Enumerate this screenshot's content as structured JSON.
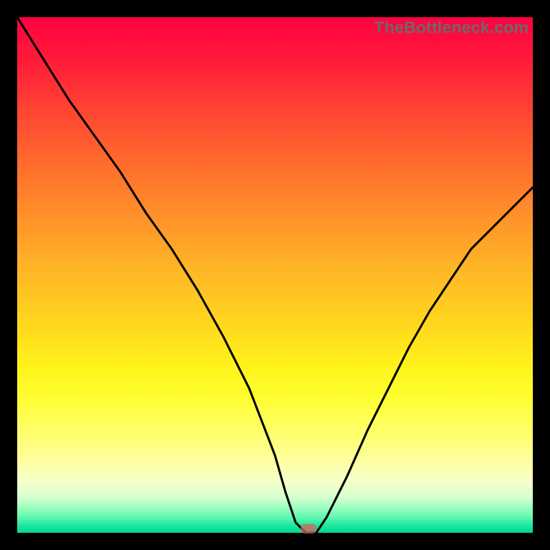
{
  "watermark": "TheBottleneck.com",
  "chart_data": {
    "type": "line",
    "title": "",
    "xlabel": "",
    "ylabel": "",
    "xlim": [
      0,
      1
    ],
    "ylim": [
      0,
      1
    ],
    "x": [
      0.0,
      0.05,
      0.1,
      0.15,
      0.2,
      0.25,
      0.3,
      0.35,
      0.4,
      0.45,
      0.5,
      0.52,
      0.54,
      0.56,
      0.58,
      0.6,
      0.64,
      0.68,
      0.72,
      0.76,
      0.8,
      0.84,
      0.88,
      0.92,
      0.96,
      1.0
    ],
    "values": [
      1.0,
      0.92,
      0.84,
      0.77,
      0.7,
      0.62,
      0.55,
      0.47,
      0.38,
      0.28,
      0.15,
      0.08,
      0.02,
      0.0,
      0.0,
      0.03,
      0.11,
      0.2,
      0.28,
      0.36,
      0.43,
      0.49,
      0.55,
      0.59,
      0.63,
      0.67
    ],
    "gradient_colors": {
      "top": "#ff0040",
      "mid": "#ffd21f",
      "bottom": "#00d890"
    },
    "marker": {
      "x_frac": 0.565,
      "y_frac": 0.992,
      "color": "#d95f5f"
    }
  }
}
